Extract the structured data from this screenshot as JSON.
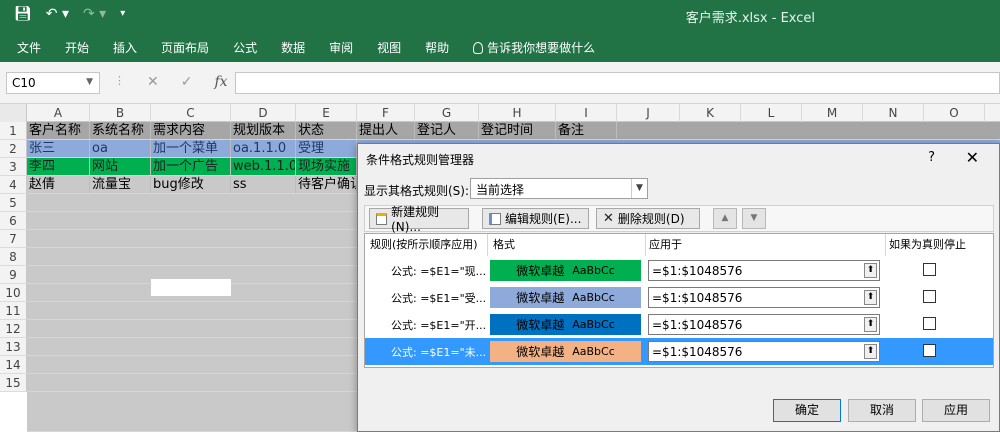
{
  "title_bar": {
    "doc_title": "客户需求.xlsx  -  Excel"
  },
  "ribbon": {
    "tabs": [
      "文件",
      "开始",
      "插入",
      "页面布局",
      "公式",
      "数据",
      "审阅",
      "视图",
      "帮助"
    ],
    "tell_me": "告诉我你想要做什么"
  },
  "formula_bar": {
    "name_box": "C10",
    "fx": "fx",
    "value": ""
  },
  "grid": {
    "columns": [
      "A",
      "B",
      "C",
      "D",
      "E",
      "F",
      "G",
      "H",
      "I",
      "J",
      "K",
      "L",
      "M",
      "N",
      "O"
    ],
    "rows": [
      "1",
      "2",
      "3",
      "4",
      "5",
      "6",
      "7",
      "8",
      "9",
      "10",
      "11",
      "12",
      "13",
      "14",
      "15"
    ],
    "data": [
      [
        "客户名称",
        "系统名称",
        "需求内容",
        "规划版本",
        "状态",
        "提出人",
        "登记人",
        "登记时间",
        "备注"
      ],
      [
        "张三",
        "oa",
        "加一个菜单",
        "oa.1.1.0",
        "受理",
        "",
        "",
        "",
        ""
      ],
      [
        "李四",
        "网站",
        "加一个广告",
        "web.1.1.0",
        "现场实施",
        "",
        "",
        "",
        ""
      ],
      [
        "赵倩",
        "流量宝",
        "bug修改",
        "ss",
        "待客户确认",
        "",
        "",
        "",
        ""
      ]
    ]
  },
  "dialog": {
    "title": "条件格式规则管理器",
    "help": "?",
    "close": "✕",
    "show_rules_label": "显示其格式规则(S):",
    "show_rules_value": "当前选择",
    "buttons": {
      "new": "新建规则(N)...",
      "edit": "编辑规则(E)...",
      "delete": "删除规则(D)"
    },
    "headers": {
      "rule": "规则(按所示顺序应用)",
      "format": "格式",
      "applies_to": "应用于",
      "stop_if_true": "如果为真则停止"
    },
    "rules": [
      {
        "rule": "公式: =$E1=\"现...",
        "format_zh": "微软卓越",
        "format_en": "AaBbCc",
        "format_color": "#00b050",
        "applies_to": "=$1:$1048576",
        "stop": false
      },
      {
        "rule": "公式: =$E1=\"受...",
        "format_zh": "微软卓越",
        "format_en": "AaBbCc",
        "format_color": "#8eaadb",
        "applies_to": "=$1:$1048576",
        "stop": false
      },
      {
        "rule": "公式: =$E1=\"开...",
        "format_zh": "微软卓越",
        "format_en": "AaBbCc",
        "format_color": "#0070c0",
        "applies_to": "=$1:$1048576",
        "stop": false
      },
      {
        "rule": "公式: =$E1=\"未...",
        "format_zh": "微软卓越",
        "format_en": "AaBbCc",
        "format_color": "#f4b183",
        "applies_to": "=$1:$1048576",
        "stop": false
      }
    ],
    "ok": "确定",
    "cancel": "取消",
    "apply": "应用"
  },
  "colors": {
    "excel_green": "#217346",
    "selection_blue": "#3399ff"
  }
}
